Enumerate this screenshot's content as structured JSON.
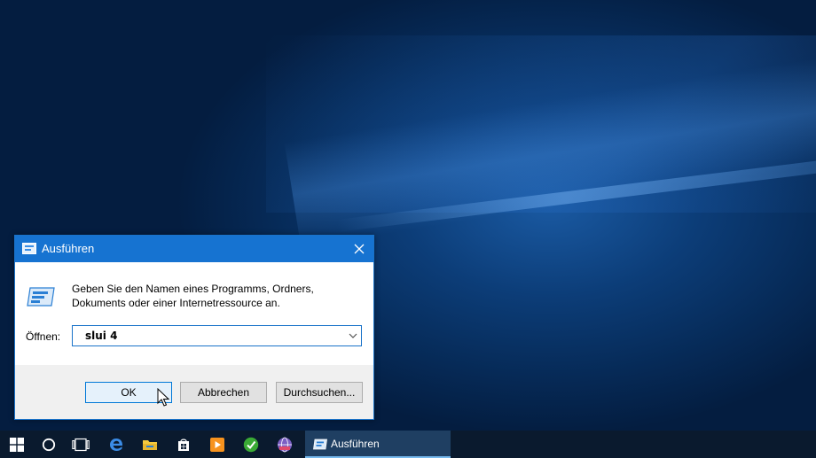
{
  "dialog": {
    "title": "Ausführen",
    "description_line1": "Geben Sie den Namen eines Programms, Ordners,",
    "description_line2": "Dokuments oder einer Internetressource an.",
    "open_label": "Öffnen:",
    "open_value": "slui 4",
    "ok_label": "OK",
    "cancel_label": "Abbrechen",
    "browse_label": "Durchsuchen..."
  },
  "taskbar": {
    "items": [
      {
        "icon": "windows-start-icon"
      },
      {
        "icon": "cortana-icon"
      },
      {
        "icon": "task-view-icon"
      },
      {
        "icon": "edge-icon"
      },
      {
        "icon": "file-explorer-icon"
      },
      {
        "icon": "store-icon"
      },
      {
        "icon": "media-player-icon"
      },
      {
        "icon": "green-check-app-icon"
      },
      {
        "icon": "globe-app-icon"
      }
    ],
    "active_task_label": "Ausführen"
  },
  "colors": {
    "accent": "#1673d1",
    "taskbar": "#0a1a2e",
    "active_task": "#1f3f62"
  }
}
